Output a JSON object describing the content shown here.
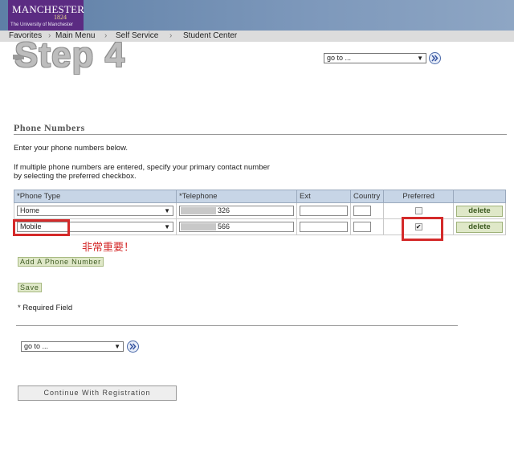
{
  "header": {
    "logo_name": "MANCHESTER",
    "logo_year": "1824",
    "logo_sub": "The University of Manchester"
  },
  "nav": {
    "items": [
      "Favorites",
      "Main Menu",
      "Self Service",
      "Student Center"
    ],
    "separator": "›"
  },
  "overlay_step": "Step 4",
  "goto": {
    "value": "go to ...",
    "arrow": "▼"
  },
  "section": {
    "title": "Phone Numbers",
    "intro": "Enter your phone numbers below.",
    "help_line1": "If multiple phone numbers are entered, specify your primary contact number",
    "help_line2": "by selecting the preferred checkbox."
  },
  "table": {
    "headers": [
      "*Phone Type",
      "*Telephone",
      "Ext",
      "Country",
      "Preferred",
      ""
    ],
    "rows": [
      {
        "phone_type": "Home",
        "telephone_tail": "326",
        "preferred": false,
        "delete_label": "delete"
      },
      {
        "phone_type": "Mobile",
        "telephone_tail": "566",
        "preferred": true,
        "delete_label": "delete"
      }
    ]
  },
  "annotation_note": "非常重要！",
  "buttons": {
    "add_phone": "Add A Phone Number",
    "save": "Save",
    "continue": "Continue With Registration"
  },
  "required_text": "* Required Field",
  "colors": {
    "accent_red": "#d42a2a",
    "header_purple": "#5b2b82",
    "table_header": "#c7d5e6",
    "button_green": "#dfe8c8"
  }
}
